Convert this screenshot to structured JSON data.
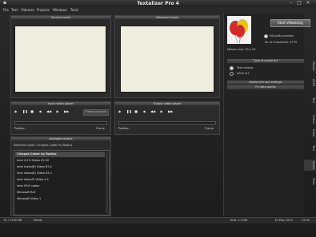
{
  "window": {
    "title": "Textalizer Pro 4"
  },
  "menu": [
    "File",
    "Text",
    "Videoize",
    "Projects",
    "Windows",
    "Tools"
  ],
  "source": {
    "header": "Source movie"
  },
  "videoized": {
    "header": "Videoized movie"
  },
  "input_player": {
    "header": "Input video player",
    "frame_btn": "Frame as source",
    "position": "Position",
    "frame": "Frame"
  },
  "output_player": {
    "header": "Output video player",
    "position": "Position",
    "frame": "Frame"
  },
  "codecs": {
    "header": "Available codecs",
    "selected_label": "Selected codec: Cinepak Codec by Radius",
    "items": [
      "Cinepak Codec by Radius",
      "Intel 4:2:0 Video V2.50",
      "Intel Indeo(R) Video R3.2",
      "Intel Indeo(R) Video R3.2",
      "Intel Indeo® Video 4.5",
      "Intel IYUV codec",
      "Microsoft RLE",
      "Microsoft Video 1"
    ]
  },
  "right": {
    "start_btn": "Start Videoizing",
    "hq_preview": "HQuality preview",
    "chars_label": "Nr. of characters: 4770",
    "mosaic_size": "Mosaic size: 30 x 22",
    "type_header": "Type of movie art",
    "option1": "Text mosaic",
    "option2": "ASCII art",
    "media_header": "Media info and settings",
    "fx_header": "FX data points"
  },
  "side_tabs": [
    "Mosaic",
    "ASCII",
    "Text",
    "Colors",
    "Draw",
    "Text",
    "Video",
    "Tools"
  ],
  "status": {
    "size": "70 / 1128 MB",
    "state": "Ready",
    "filesize": "Size: 2.5 Mb",
    "date": "10 May 2012",
    "time": "12:43"
  }
}
